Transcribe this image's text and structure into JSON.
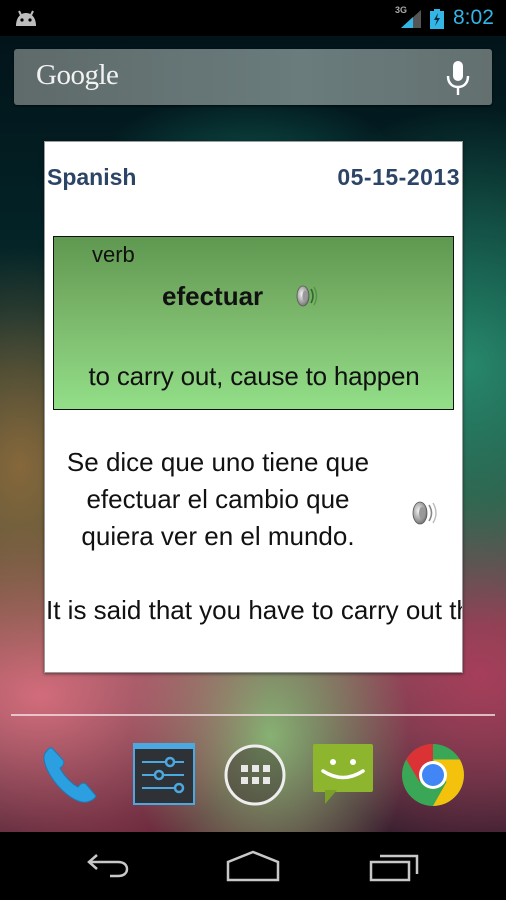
{
  "status_bar": {
    "network_type": "3G",
    "time": "8:02",
    "icons": [
      "android-debug-icon",
      "signal-icon",
      "battery-charging-icon"
    ],
    "accent_color": "#33b5e5"
  },
  "search_bar": {
    "label": "Google",
    "icons": [
      "mic-icon"
    ]
  },
  "widget": {
    "language": "Spanish",
    "date": "05-15-2013",
    "word_card": {
      "part_of_speech": "verb",
      "word": "efectuar",
      "definition": "to carry out, cause to happen"
    },
    "example_spanish": "Se dice que uno tiene que efectuar el cambio que quiera ver en el mundo.",
    "example_english": "It is said that you have to carry out the change you",
    "header_color": "#2c4466",
    "card_color": "#7bbf6c"
  },
  "dock": {
    "apps": [
      {
        "name": "Phone",
        "icon": "phone-icon"
      },
      {
        "name": "Settings",
        "icon": "settings-icon"
      },
      {
        "name": "Apps",
        "icon": "app-drawer-icon"
      },
      {
        "name": "Messaging",
        "icon": "messaging-icon"
      },
      {
        "name": "Chrome",
        "icon": "chrome-icon"
      }
    ]
  },
  "nav_bar": {
    "buttons": [
      {
        "name": "Back",
        "icon": "back-icon"
      },
      {
        "name": "Home",
        "icon": "home-icon"
      },
      {
        "name": "Recent apps",
        "icon": "recents-icon"
      }
    ]
  }
}
